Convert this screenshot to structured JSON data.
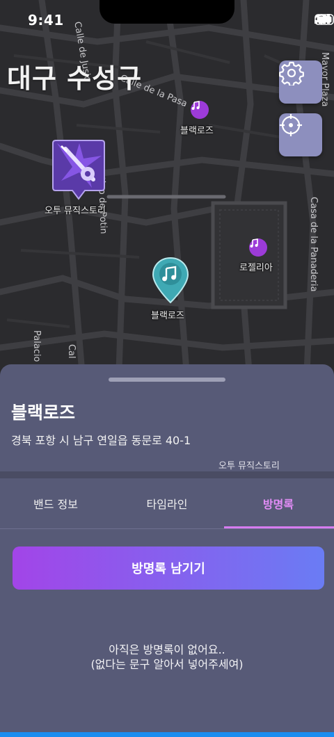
{
  "status_bar": {
    "time": "9:41"
  },
  "map": {
    "region_title": "대구 수성구",
    "streets": [
      "Calle de Jusio",
      "Calle de la Pasa",
      "Mayor Plaza",
      "Casa de la Panaderia",
      "Sarqtino de Potin",
      "Palacio",
      "Cal"
    ],
    "markers": [
      {
        "label": "블랙로즈",
        "type": "music"
      },
      {
        "label": "오투 뮤직스토리",
        "type": "guitar-thumbnail"
      },
      {
        "label": "로젤리아",
        "type": "music"
      },
      {
        "label": "블랙로즈",
        "type": "selected-music"
      }
    ],
    "buttons": {
      "settings": "gear-icon",
      "locate": "crosshair-icon"
    }
  },
  "sheet": {
    "place_name": "블랙로즈",
    "address": "경북 포항 시 남구 연일읍 동문로 40-1",
    "peek_label": "오투 뮤직스토리",
    "tabs": [
      {
        "label": "밴드 정보",
        "active": false
      },
      {
        "label": "타임라인",
        "active": false
      },
      {
        "label": "방명록",
        "active": true
      }
    ],
    "cta_label": "방명록 남기기",
    "empty_line1": "아직은 방명록이 없어요..",
    "empty_line2": "(없다는 문구 알아서 넣어주세여)"
  },
  "colors": {
    "accent": "#d67cf0",
    "button_bg": "#8d8fbe",
    "sheet_bg": "#575a77",
    "cta_start": "#a245e8",
    "cta_end": "#6a7cf4",
    "pin_teal": "#3fa9b4",
    "pin_purple": "#9c3bd8"
  }
}
